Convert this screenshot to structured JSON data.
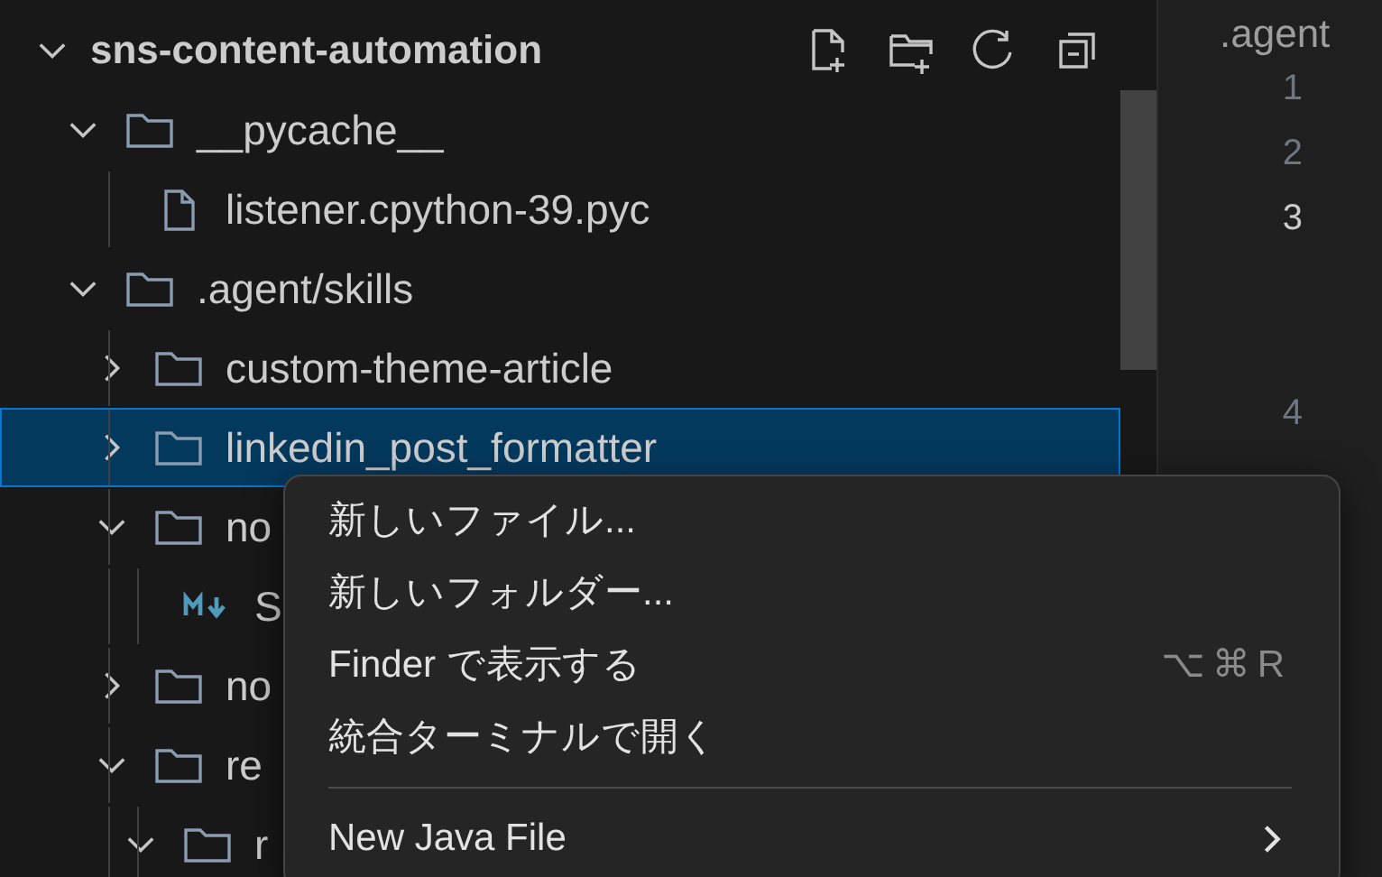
{
  "explorer": {
    "root": {
      "label": "sns-content-automation",
      "expanded": true
    },
    "tree": [
      {
        "label": "__pycache__",
        "kind": "folder",
        "expanded": true,
        "selected": false,
        "children": [
          {
            "label": "listener.cpython-39.pyc",
            "kind": "file",
            "selected": false
          }
        ]
      },
      {
        "label": ".agent/skills",
        "kind": "folder",
        "expanded": true,
        "selected": false,
        "children": [
          {
            "label": "custom-theme-article",
            "kind": "folder",
            "expanded": false,
            "selected": false
          },
          {
            "label": "linkedin_post_formatter",
            "kind": "folder",
            "expanded": false,
            "selected": true
          },
          {
            "label": "no",
            "kind": "folder",
            "expanded": true,
            "selected": false,
            "children": [
              {
                "label": "S",
                "kind": "markdown",
                "selected": false
              }
            ]
          },
          {
            "label": "no",
            "kind": "folder",
            "expanded": false,
            "selected": false
          },
          {
            "label": "re",
            "kind": "folder",
            "expanded": true,
            "selected": false,
            "children": [
              {
                "label": "r",
                "kind": "folder",
                "expanded": true,
                "selected": false
              }
            ]
          }
        ]
      }
    ]
  },
  "editor": {
    "tab": ".agent",
    "line_numbers": [
      {
        "label": "1",
        "active": false
      },
      {
        "label": "2",
        "active": false
      },
      {
        "label": "3",
        "active": true
      },
      {
        "label": "4",
        "active": false
      }
    ]
  },
  "context_menu": [
    {
      "kind": "item",
      "label": "新しいファイル..."
    },
    {
      "kind": "item",
      "label": "新しいフォルダー..."
    },
    {
      "kind": "item",
      "label": "Finder で表示する",
      "shortcut": "⌥⌘R"
    },
    {
      "kind": "item",
      "label": "統合ターミナルで開く"
    },
    {
      "kind": "separator"
    },
    {
      "kind": "item",
      "label": "New Java File",
      "submenu": true
    }
  ]
}
